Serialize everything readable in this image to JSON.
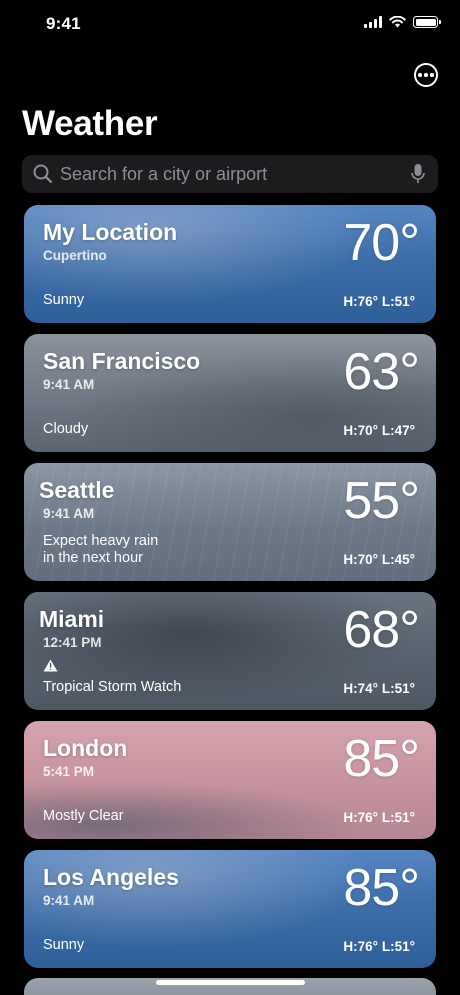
{
  "status": {
    "time": "9:41"
  },
  "header": {
    "title": "Weather"
  },
  "search": {
    "placeholder": "Search for a city or airport"
  },
  "cards": [
    {
      "city": "My Location",
      "sub": "Cupertino",
      "temp": "70°",
      "condition": "Sunny",
      "hilo": "H:76°  L:51°"
    },
    {
      "city": "San Francisco",
      "sub": "9:41 AM",
      "temp": "63°",
      "condition": "Cloudy",
      "hilo": "H:70°  L:47°"
    },
    {
      "city": "Seattle",
      "sub": "9:41 AM",
      "temp": "55°",
      "condition_line1": "Expect heavy rain",
      "condition_line2": "in the next hour",
      "hilo": "H:70°  L:45°"
    },
    {
      "city": "Miami",
      "sub": "12:41 PM",
      "temp": "68°",
      "condition": "Tropical Storm Watch",
      "hilo": "H:74°  L:51°",
      "alert_icon": "warning-icon"
    },
    {
      "city": "London",
      "sub": "5:41 PM",
      "temp": "85°",
      "condition": "Mostly Clear",
      "hilo": "H:76°  L:51°"
    },
    {
      "city": "Los Angeles",
      "sub": "9:41 AM",
      "temp": "85°",
      "condition": "Sunny",
      "hilo": "H:76°  L:51°"
    }
  ],
  "icons": {
    "more": "ellipsis-circle-icon",
    "search": "search-icon",
    "mic": "microphone-icon",
    "signal": "cellular-signal-icon",
    "wifi": "wifi-icon",
    "battery": "battery-icon"
  },
  "colors": {
    "background": "#000000",
    "search_field": "#1c1c1e",
    "placeholder": "#8e8e93"
  }
}
